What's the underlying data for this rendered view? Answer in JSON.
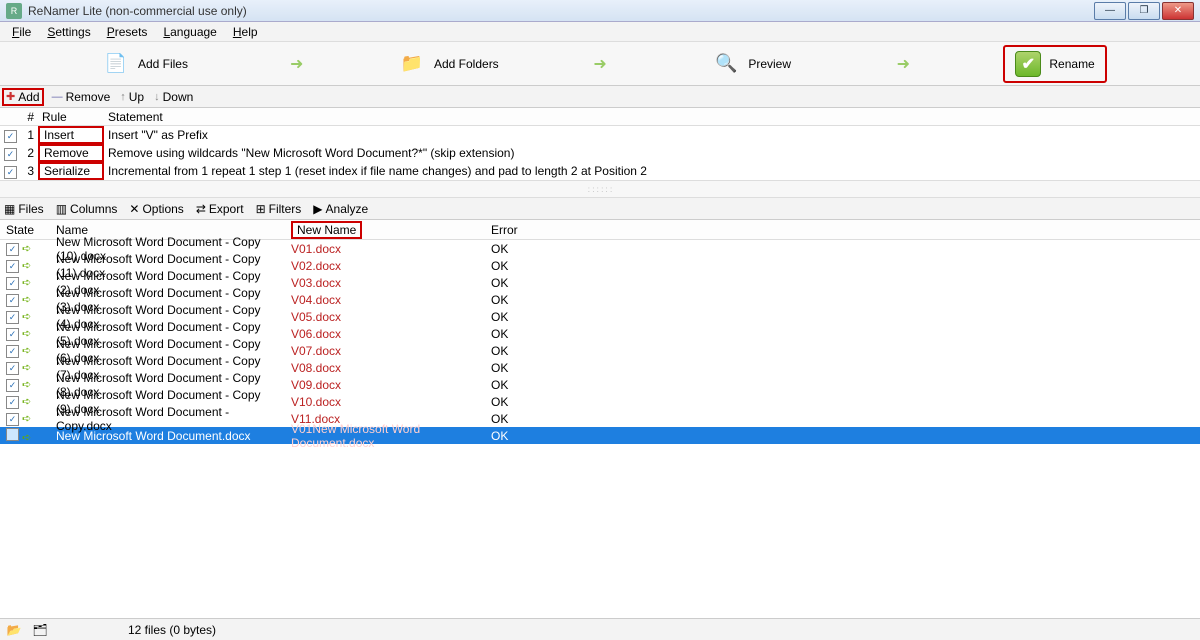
{
  "window": {
    "title": "ReNamer Lite (non-commercial use only)"
  },
  "menu": {
    "file": "File",
    "settings": "Settings",
    "presets": "Presets",
    "language": "Language",
    "help": "Help"
  },
  "toolbar": {
    "add_files": "Add Files",
    "add_folders": "Add Folders",
    "preview": "Preview",
    "rename": "Rename"
  },
  "rules_toolbar": {
    "add": "Add",
    "remove": "Remove",
    "up": "Up",
    "down": "Down"
  },
  "rules_header": {
    "num": "#",
    "rule": "Rule",
    "statement": "Statement"
  },
  "rules": [
    {
      "n": "1",
      "rule": "Insert",
      "stmt": "Insert \"V\" as Prefix"
    },
    {
      "n": "2",
      "rule": "Remove",
      "stmt": "Remove using wildcards \"New Microsoft Word Document?*\" (skip extension)"
    },
    {
      "n": "3",
      "rule": "Serialize",
      "stmt": "Incremental from 1 repeat 1 step 1 (reset index if file name changes) and pad to length 2 at Position 2"
    }
  ],
  "files_toolbar": {
    "files": "Files",
    "columns": "Columns",
    "options": "Options",
    "export": "Export",
    "filters": "Filters",
    "analyze": "Analyze"
  },
  "files_header": {
    "state": "State",
    "name": "Name",
    "new_name": "New Name",
    "error": "Error"
  },
  "files": [
    {
      "name": "New Microsoft Word Document - Copy (10).docx",
      "new": "V01.docx",
      "err": "OK"
    },
    {
      "name": "New Microsoft Word Document - Copy (11).docx",
      "new": "V02.docx",
      "err": "OK"
    },
    {
      "name": "New Microsoft Word Document - Copy (2).docx",
      "new": "V03.docx",
      "err": "OK"
    },
    {
      "name": "New Microsoft Word Document - Copy (3).docx",
      "new": "V04.docx",
      "err": "OK"
    },
    {
      "name": "New Microsoft Word Document - Copy (4).docx",
      "new": "V05.docx",
      "err": "OK"
    },
    {
      "name": "New Microsoft Word Document - Copy (5).docx",
      "new": "V06.docx",
      "err": "OK"
    },
    {
      "name": "New Microsoft Word Document - Copy (6).docx",
      "new": "V07.docx",
      "err": "OK"
    },
    {
      "name": "New Microsoft Word Document - Copy (7).docx",
      "new": "V08.docx",
      "err": "OK"
    },
    {
      "name": "New Microsoft Word Document - Copy (8).docx",
      "new": "V09.docx",
      "err": "OK"
    },
    {
      "name": "New Microsoft Word Document - Copy (9).docx",
      "new": "V10.docx",
      "err": "OK"
    },
    {
      "name": "New Microsoft Word Document - Copy.docx",
      "new": "V11.docx",
      "err": "OK"
    },
    {
      "name": "New Microsoft Word Document.docx",
      "new": "V01New Microsoft Word Document.docx",
      "err": "OK",
      "selected": true
    }
  ],
  "statusbar": {
    "text": "12 files (0 bytes)"
  }
}
